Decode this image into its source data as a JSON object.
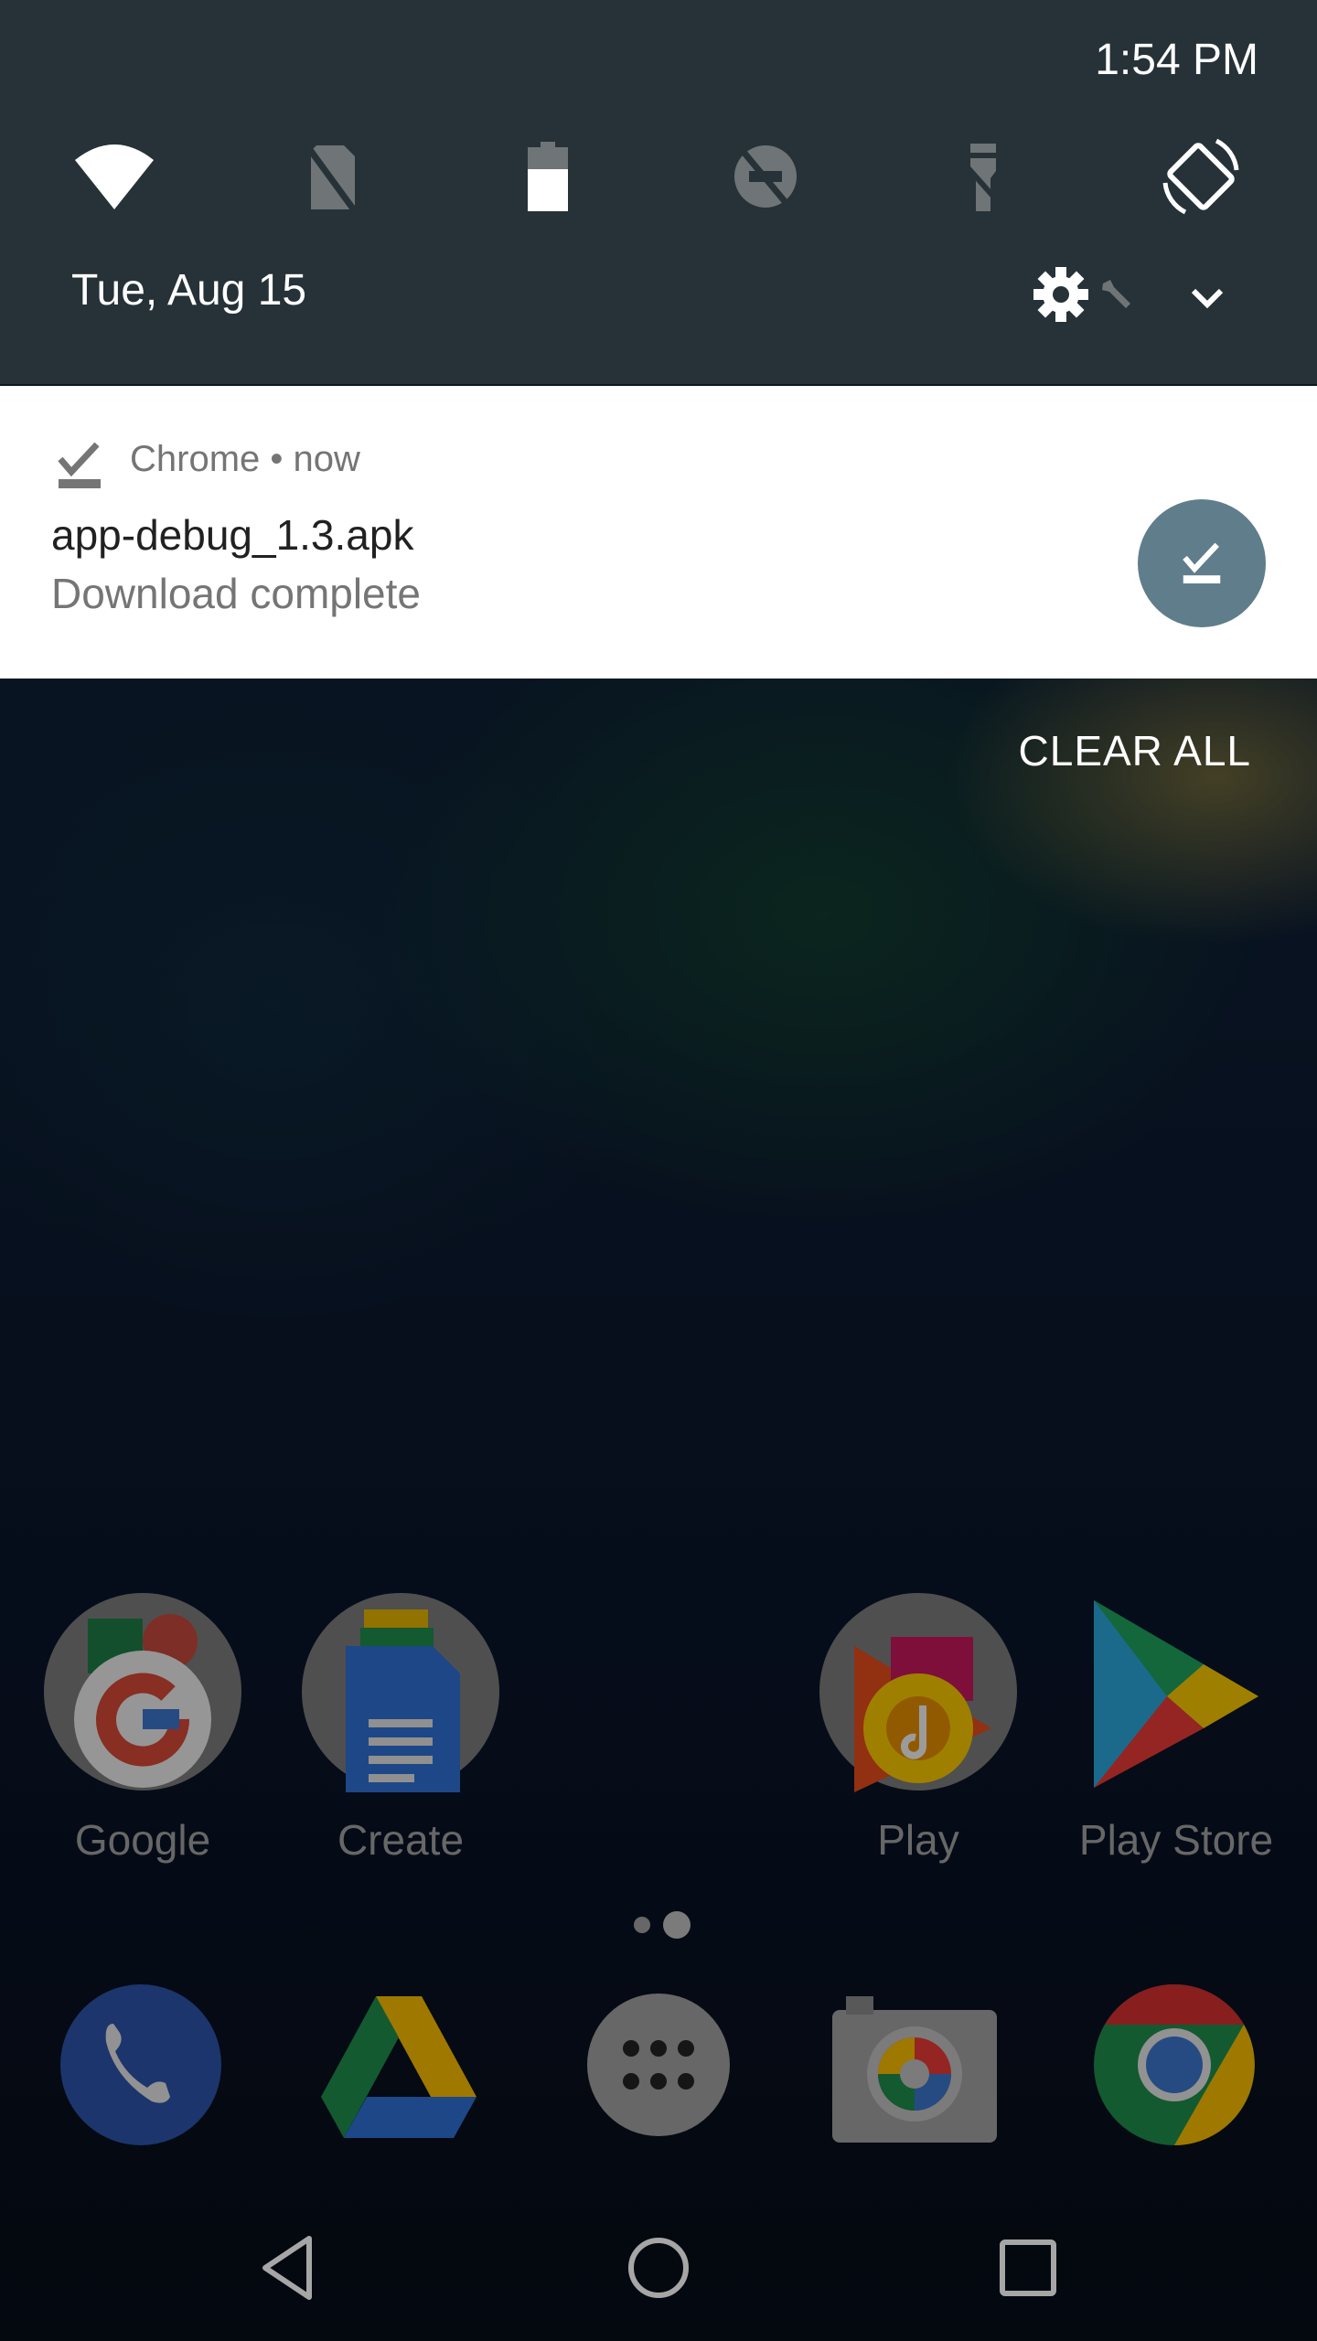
{
  "status": {
    "time": "1:54 PM"
  },
  "quick_settings": {
    "date": "Tue, Aug 15",
    "tiles": [
      {
        "icon": "wifi-icon",
        "state": "on"
      },
      {
        "icon": "no-sim-icon",
        "state": "off"
      },
      {
        "icon": "battery-icon",
        "state": "on"
      },
      {
        "icon": "do-not-disturb-off-icon",
        "state": "off"
      },
      {
        "icon": "flashlight-off-icon",
        "state": "off"
      },
      {
        "icon": "auto-rotate-icon",
        "state": "on"
      }
    ]
  },
  "notification": {
    "app": "Chrome",
    "separator": "•",
    "when": "now",
    "app_line": "Chrome • now",
    "title": "app-debug_1.3.apk",
    "subtitle": "Download complete",
    "accent": "#607d8b"
  },
  "clear_all_label": "CLEAR ALL",
  "home": {
    "apps": [
      {
        "label": "Google",
        "icon": "google-folder-icon"
      },
      {
        "label": "Create",
        "icon": "create-folder-icon"
      },
      {
        "label": "Play",
        "icon": "play-folder-icon"
      },
      {
        "label": "Play Store",
        "icon": "play-store-icon"
      }
    ],
    "page_count": 2,
    "current_page": 2,
    "dock": [
      {
        "name": "Phone",
        "icon": "phone-icon"
      },
      {
        "name": "Drive",
        "icon": "drive-icon"
      },
      {
        "name": "App drawer",
        "icon": "app-drawer-icon"
      },
      {
        "name": "Camera",
        "icon": "camera-icon"
      },
      {
        "name": "Chrome",
        "icon": "chrome-icon"
      }
    ]
  },
  "colors": {
    "shade": "#263238",
    "notification_bg": "#ffffff"
  }
}
